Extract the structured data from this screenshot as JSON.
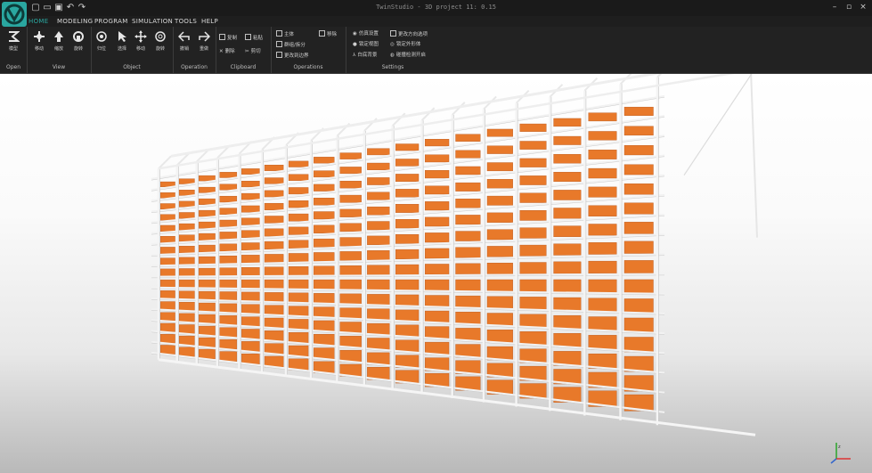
{
  "window": {
    "title": "TwinStudio - 3D project 11: 0.15"
  },
  "menu": {
    "tabs": [
      "HOME",
      "MODELING",
      "PROGRAM",
      "SIMULATION",
      "TOOLS",
      "HELP"
    ],
    "active": "HOME"
  },
  "ribbon": {
    "groups": [
      {
        "label": "Open",
        "buttons": [
          "模型"
        ]
      },
      {
        "label": "View",
        "buttons": [
          "移动",
          "缩放",
          "旋转"
        ]
      },
      {
        "label": "Object",
        "buttons": [
          "归位",
          "选择",
          "移动",
          "旋转"
        ]
      },
      {
        "label": "Operation",
        "buttons": [
          "撤销",
          "重做"
        ]
      },
      {
        "label": "Clipboard",
        "buttons": [
          "复制",
          "粘贴",
          "删除",
          "剪切"
        ]
      },
      {
        "label": "Operations",
        "buttons": [
          "主体",
          "群组/拆分",
          "更改到边界",
          "移除"
        ]
      },
      {
        "label": "Settings",
        "buttons": [
          "仿真设置",
          "锁定视图",
          "白底背景",
          "更改方向选项",
          "锁定外形体",
          "碰撞检测开启"
        ]
      }
    ]
  },
  "accent_color": "#2aa7a0",
  "box_color": "#e8792a",
  "icons": [
    "logo-icon",
    "new-file-icon",
    "open-icon",
    "save-icon",
    "undo-icon",
    "redo-icon",
    "axes-gizmo-icon"
  ]
}
